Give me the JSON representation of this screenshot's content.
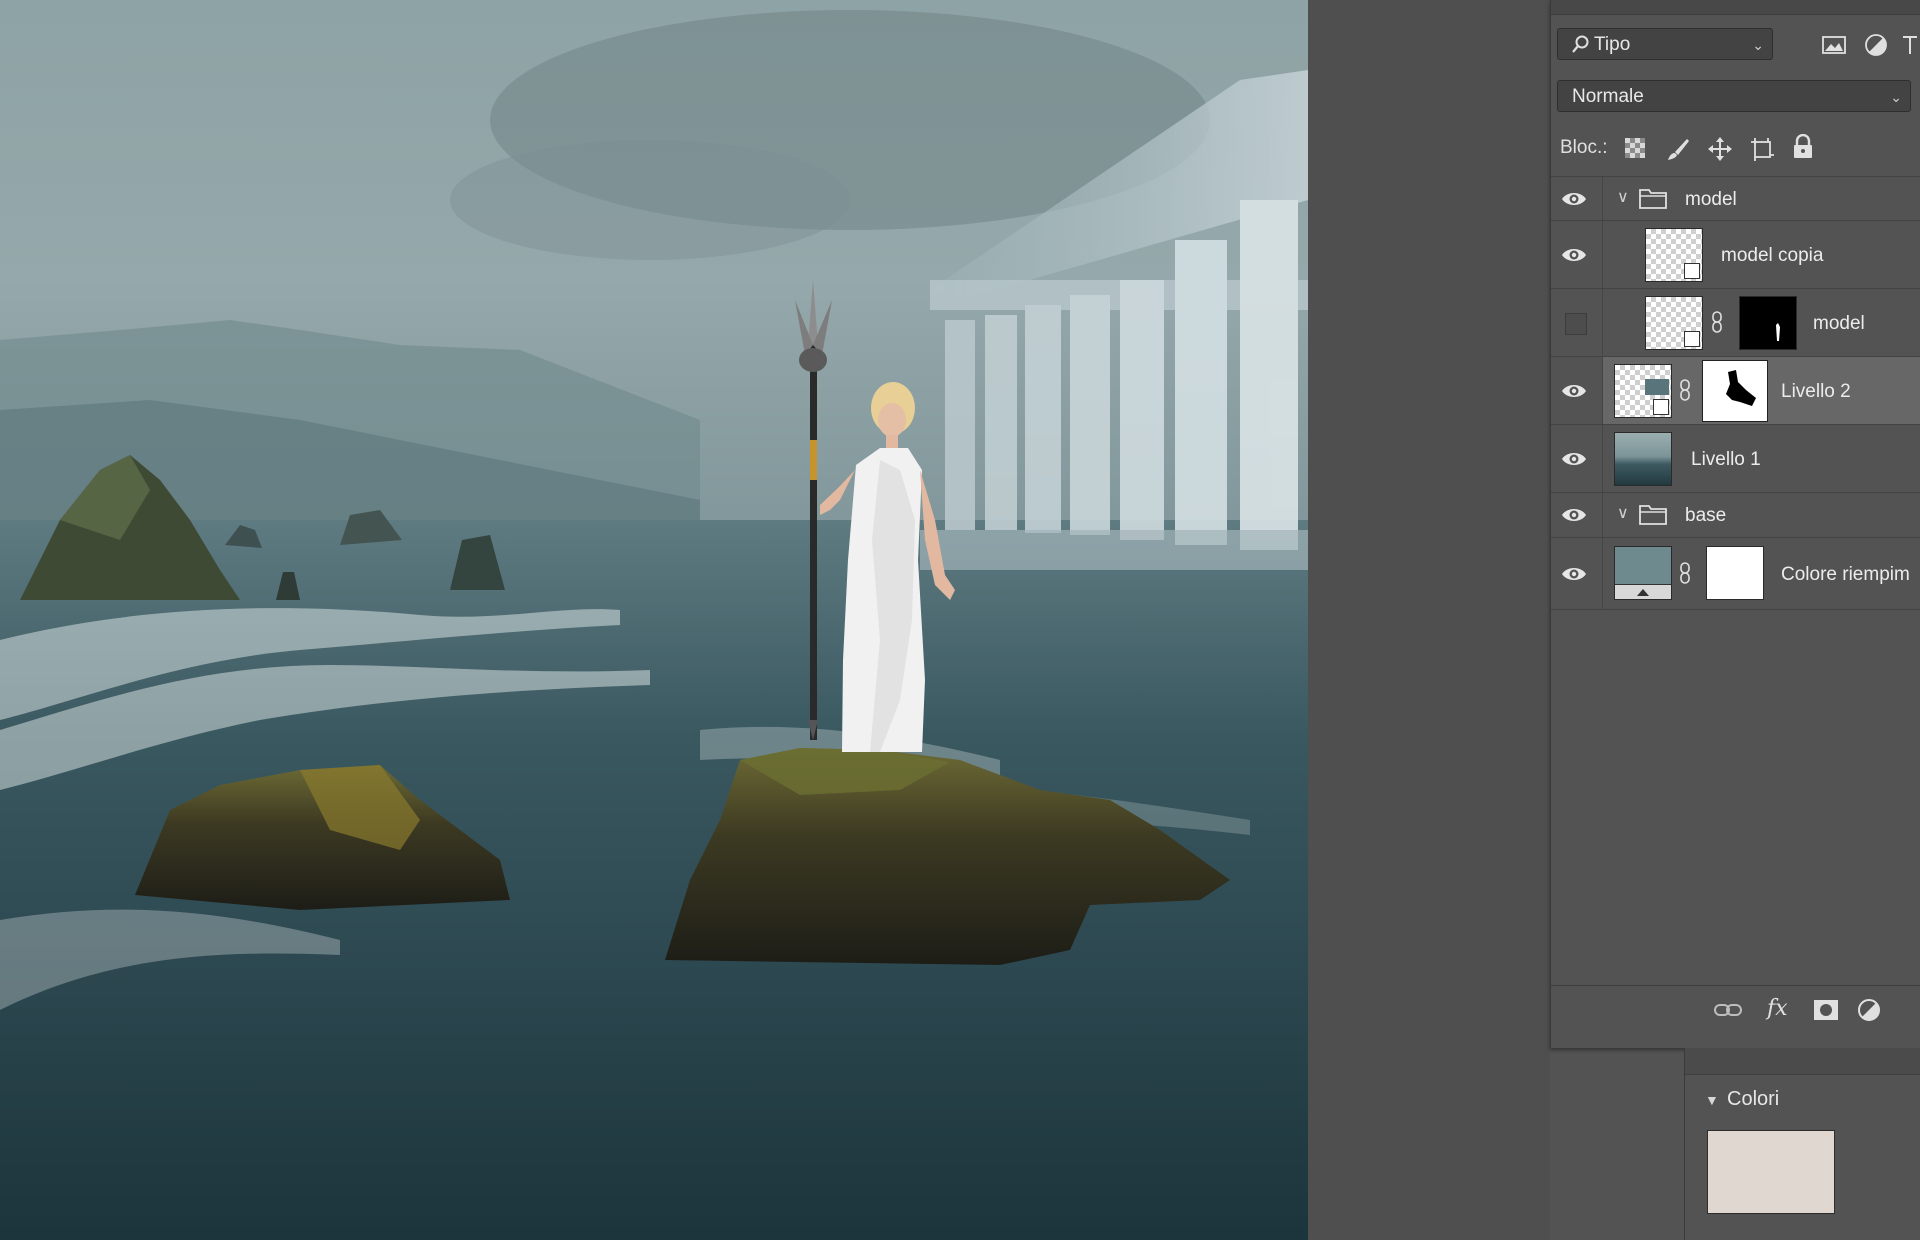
{
  "layers_panel": {
    "filter_kind": "Tipo",
    "blend_mode": "Normale",
    "lock_label": "Bloc.:",
    "layers": [
      {
        "name": "model",
        "type": "group",
        "visible": true,
        "expanded": true
      },
      {
        "name": "model copia",
        "type": "smart-object",
        "visible": true
      },
      {
        "name": "model",
        "type": "smart-object-with-mask",
        "visible": false
      },
      {
        "name": "Livello 2",
        "type": "smart-object-with-mask",
        "visible": true,
        "selected": true
      },
      {
        "name": "Livello 1",
        "type": "image",
        "visible": true
      },
      {
        "name": "base",
        "type": "group",
        "visible": true,
        "expanded": true
      },
      {
        "name": "Colore riempim",
        "type": "fill-layer-with-mask",
        "visible": true
      }
    ],
    "bottom_icons": [
      "link-layers-icon",
      "fx-icon",
      "add-mask-icon",
      "adjustment-icon"
    ]
  },
  "colors_panel": {
    "title": "Colori",
    "swatch_color": "#e0d8d0"
  },
  "colors": {
    "panel_bg": "#535353",
    "selected_row": "#676767",
    "fill_thumb": "#6f8a8f"
  }
}
